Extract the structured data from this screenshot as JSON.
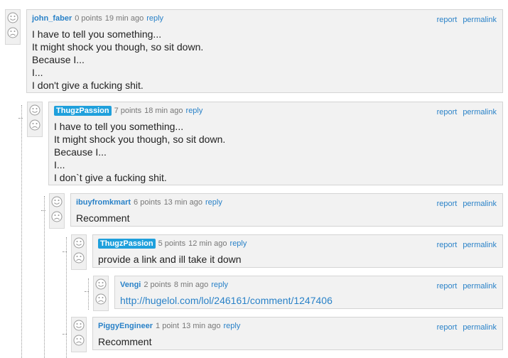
{
  "vote": {
    "up_icon": "smile-icon",
    "down_icon": "frown-icon"
  },
  "actions": {
    "report": "report",
    "permalink": "permalink",
    "reply": "reply"
  },
  "comments": [
    {
      "user": "john_faber",
      "badge": false,
      "points": "0 points",
      "ago": "19 min ago",
      "lines": [
        "I have to tell you something...",
        "It might shock you though, so sit down.",
        "Because I...",
        "I...",
        "I don't give a fucking shit."
      ]
    },
    {
      "user": "ThugzPassion",
      "badge": true,
      "points": "7 points",
      "ago": "18 min ago",
      "lines": [
        "I have to tell you something...",
        "It might shock you though, so sit down.",
        "Because I...",
        "I...",
        "I don`t give a fucking shit."
      ]
    },
    {
      "user": "ibuyfromkmart",
      "badge": false,
      "points": "6 points",
      "ago": "13 min ago",
      "lines": [
        "Recomment"
      ]
    },
    {
      "user": "ThugzPassion",
      "badge": true,
      "points": "5 points",
      "ago": "12 min ago",
      "lines": [
        "provide a link and ill take it down"
      ]
    },
    {
      "user": "Vengi",
      "badge": false,
      "points": "2 points",
      "ago": "8 min ago",
      "lines": [
        "http://hugelol.com/lol/246161/comment/1247406"
      ]
    },
    {
      "user": "PiggyEngineer",
      "badge": false,
      "points": "1 point",
      "ago": "13 min ago",
      "lines": [
        "Recomment"
      ]
    }
  ]
}
